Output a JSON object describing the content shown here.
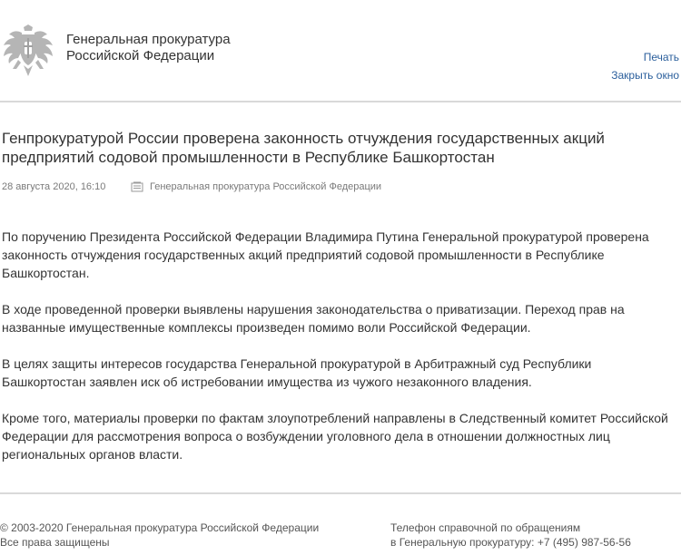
{
  "header": {
    "org_name_line1": "Генеральная прокуратура",
    "org_name_line2": "Российской Федерации",
    "print_label": "Печать",
    "close_label": "Закрыть окно",
    "logo_icon": "double-headed-eagle-emblem-icon"
  },
  "article": {
    "title": "Генпрокуратурой России проверена законность отчуждения государственных акций предприятий содовой промышленности в Республике Башкортостан",
    "date": "28 августа 2020, 16:10",
    "source_icon": "document-icon",
    "source": "Генеральная прокуратура Российской Федерации",
    "paragraphs": [
      "По поручению Президента Российской Федерации Владимира Путина Генеральной прокуратурой проверена законность отчуждения государственных акций предприятий содовой промышленности в Республике Башкортостан.",
      "В ходе проведенной проверки выявлены нарушения законодательства о приватизации. Переход прав на названные имущественные комплексы произведен помимо воли Российской Федерации.",
      "В целях защиты интересов государства Генеральной прокуратурой в Арбитражный суд Республики Башкортостан заявлен иск об истребовании имущества из чужого незаконного владения.",
      "Кроме того, материалы проверки по фактам злоупотреблений направлены в Следственный комитет Российской Федерации для рассмотрения вопроса о возбуждении уголовного дела в отношении должностных лиц региональных органов власти."
    ]
  },
  "footer": {
    "copyright_line1": "© 2003-2020 Генеральная прокуратура Российской Федерации",
    "copyright_line2": "Все права защищены",
    "phone_line1": "Телефон справочной по обращениям",
    "phone_line2": "в Генеральную прокуратуру: +7 (495) 987-56-56"
  },
  "colors": {
    "link": "#2b5f9c",
    "text": "#333333",
    "meta": "#7a7a7a",
    "separator": "#d9d9d9"
  }
}
